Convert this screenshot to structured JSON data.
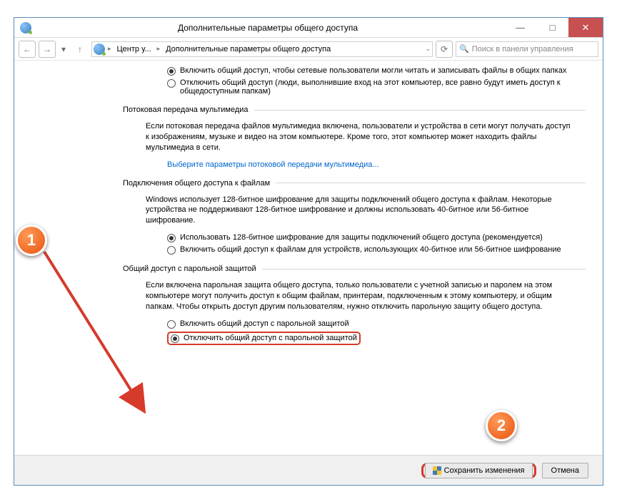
{
  "window": {
    "title": "Дополнительные параметры общего доступа"
  },
  "nav": {
    "crumb1": "Центр у...",
    "crumb2": "Дополнительные параметры общего доступа",
    "search_placeholder": "Поиск в панели управления"
  },
  "opt1": {
    "on": "Включить общий доступ, чтобы сетевые пользователи могли читать и записывать файлы в общих папках",
    "off": "Отключить общий доступ (люди, выполнившие вход на этот компьютер, все равно будут иметь доступ к общедоступным папкам)"
  },
  "sec1": {
    "title": "Потоковая передача мультимедиа",
    "text": "Если потоковая передача файлов мультимедиа включена, пользователи и устройства в сети могут получать доступ к изображениям, музыке и видео на этом компьютере. Кроме того, этот компьютер может находить файлы мультимедиа в сети.",
    "link": "Выберите параметры потоковой передачи мультимедиа..."
  },
  "sec2": {
    "title": "Подключения общего доступа к файлам",
    "text": "Windows использует 128-битное шифрование для защиты подключений общего доступа к файлам. Некоторые устройства не поддерживают 128-битное шифрование и должны использовать 40-битное или 56-битное шифрование.",
    "r1": "Использовать 128-битное шифрование для защиты подключений общего доступа (рекомендуется)",
    "r2": "Включить общий доступ к файлам для устройств, использующих 40-битное или 56-битное шифрование"
  },
  "sec3": {
    "title": "Общий доступ с парольной защитой",
    "text": "Если включена парольная защита общего доступа, только пользователи с учетной записью и паролем на этом компьютере могут получить доступ к общим файлам, принтерам, подключенным к этому компьютеру, и общим папкам. Чтобы открыть доступ другим пользователям, нужно отключить парольную защиту общего доступа.",
    "r1": "Включить общий доступ с парольной защитой",
    "r2": "Отключить общий доступ с парольной защитой"
  },
  "footer": {
    "save": "Сохранить изменения",
    "cancel": "Отмена"
  },
  "markers": {
    "m1": "1",
    "m2": "2"
  }
}
